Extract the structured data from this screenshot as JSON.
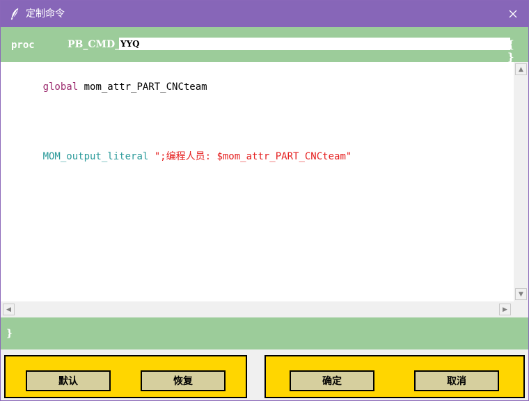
{
  "window": {
    "title": "定制命令",
    "icon": "feather-icon",
    "close_icon": "close-icon"
  },
  "header": {
    "keyword": "proc",
    "name_prefix": "PB_CMD_",
    "name_value": "YYQ",
    "brace": "{ }"
  },
  "editor": {
    "lines": [
      {
        "parts": [
          {
            "text": "global ",
            "kind": "keyword"
          },
          {
            "text": "mom_attr_PART_CNCteam",
            "kind": "plain"
          }
        ]
      },
      {
        "parts": [
          {
            "text": "MOM_output_literal ",
            "kind": "command"
          },
          {
            "text": "\";编程人员: $mom_attr_PART_CNCteam\"",
            "kind": "string"
          }
        ]
      }
    ]
  },
  "footer": {
    "brace": "}"
  },
  "buttons": {
    "default_label": "默认",
    "restore_label": "恢复",
    "ok_label": "确定",
    "cancel_label": "取消"
  },
  "colors": {
    "titlebar": "#8766b8",
    "section_bar": "#9ccc9a",
    "button_panel": "#ffd600",
    "button_face": "#d6cf9e",
    "keyword": "#9b2b6e",
    "command": "#2a9a9a",
    "string": "#e52020"
  }
}
